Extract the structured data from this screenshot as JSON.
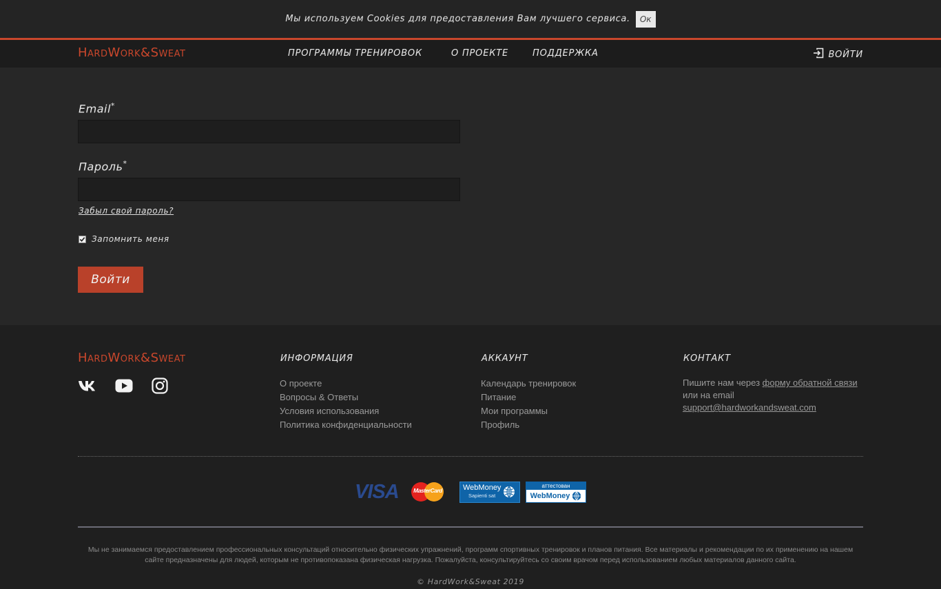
{
  "cookie": {
    "text": "Мы используем Cookies для предоставления Вам лучшего сервиса.",
    "ok_label": "Ок"
  },
  "header": {
    "logo": "HardWork&Sweat",
    "nav": [
      {
        "label": "Программы тренировок"
      },
      {
        "label": "О проекте"
      },
      {
        "label": "Поддержка"
      }
    ],
    "login_label": "Войти"
  },
  "form": {
    "email_label": "Email",
    "email_value": "",
    "password_label": "Пароль",
    "password_value": "",
    "required_mark": "*",
    "forgot_label": "Забыл свой пароль?",
    "remember_label": "Запомнить меня",
    "remember_checked": true,
    "submit_label": "Войти"
  },
  "footer": {
    "logo": "HardWork&Sweat",
    "social": [
      {
        "icon": "vk-icon"
      },
      {
        "icon": "youtube-icon"
      },
      {
        "icon": "instagram-icon"
      }
    ],
    "info": {
      "title": "Информация",
      "items": [
        "О проекте",
        "Вопросы & Ответы",
        "Условия использования",
        "Политика конфиденциальности"
      ]
    },
    "account": {
      "title": "Аккаунт",
      "items": [
        "Календарь тренировок",
        "Питание",
        "Мои программы",
        "Профиль"
      ]
    },
    "contact": {
      "title": "Контакт",
      "prefix": "Пишите нам через ",
      "form_link": "форму обратной связи",
      "middle": "или на email",
      "email": "support@hardworkandsweat.com"
    },
    "payments": {
      "visa": "VISA",
      "mastercard": "MasterCard",
      "webmoney_top": "WebMoney",
      "webmoney_sub": "Sapienti sat",
      "attested_top": "аттестован",
      "attested_bottom": "WebMoney"
    },
    "disclaimer": "Мы не занимаемся предоставлением профессиональных консультаций относительно физических упражнений, программ спортивных тренировок и планов питания. Все материалы и рекомендации по их применению на нашем сайте предназначены для людей, которым не противопоказана физическая нагрузка. Пожалуйста, консультируйтесь со своим врачом перед использованием любых материалов данного сайта.",
    "copyright": "© HardWork&Sweat 2019"
  },
  "colors": {
    "accent": "#c9472c",
    "button": "#b9412a",
    "background": "#232323"
  }
}
